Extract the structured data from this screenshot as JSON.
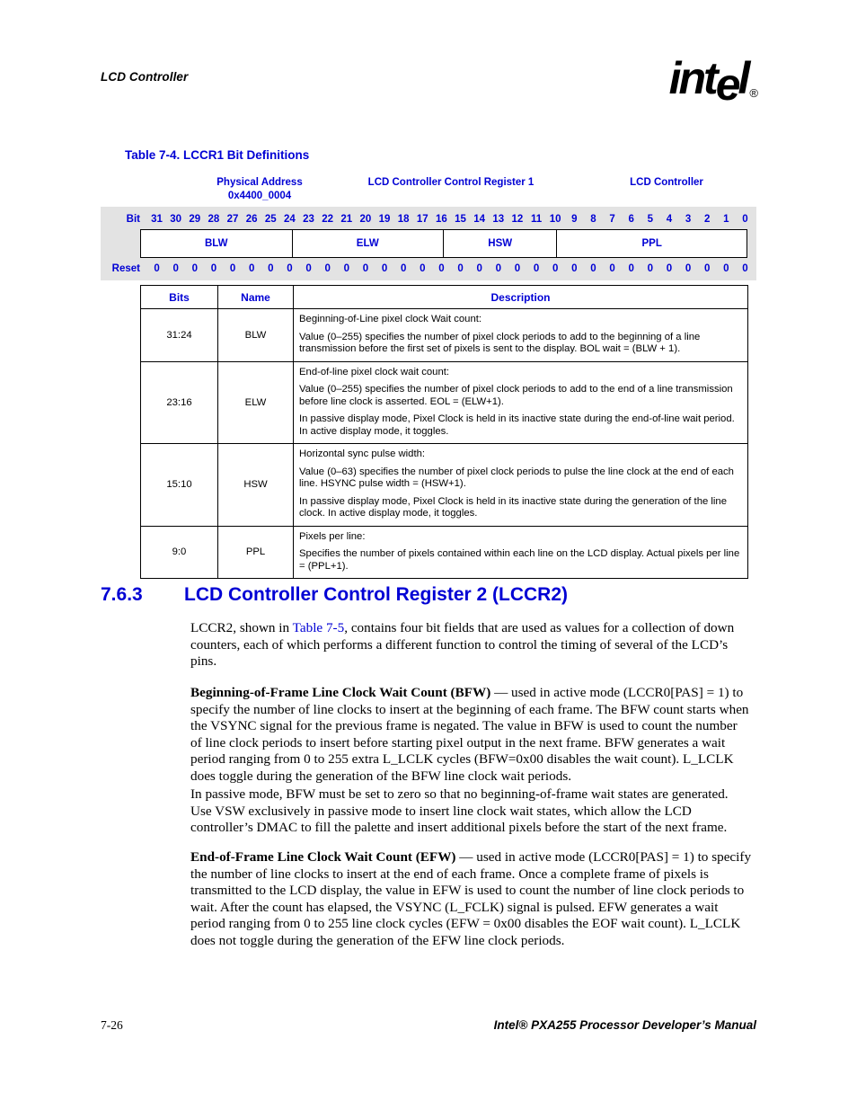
{
  "header": {
    "running_head": "LCD Controller",
    "logo_text": "intel",
    "logo_registered": "®"
  },
  "table": {
    "caption": "Table 7-4. LCCR1 Bit Definitions",
    "register_diagram": {
      "physical_address_label": "Physical Address",
      "physical_address_value": "0x4400_0004",
      "register_name": "LCD Controller Control Register 1",
      "unit_name": "LCD Controller",
      "bit_row_label": "Bit",
      "reset_row_label": "Reset",
      "bits": [
        "31",
        "30",
        "29",
        "28",
        "27",
        "26",
        "25",
        "24",
        "23",
        "22",
        "21",
        "20",
        "19",
        "18",
        "17",
        "16",
        "15",
        "14",
        "13",
        "12",
        "11",
        "10",
        "9",
        "8",
        "7",
        "6",
        "5",
        "4",
        "3",
        "2",
        "1",
        "0"
      ],
      "reset_values": [
        "0",
        "0",
        "0",
        "0",
        "0",
        "0",
        "0",
        "0",
        "0",
        "0",
        "0",
        "0",
        "0",
        "0",
        "0",
        "0",
        "0",
        "0",
        "0",
        "0",
        "0",
        "0",
        "0",
        "0",
        "0",
        "0",
        "0",
        "0",
        "0",
        "0",
        "0",
        "0"
      ],
      "fields": [
        {
          "name": "BLW",
          "span": 8
        },
        {
          "name": "ELW",
          "span": 8
        },
        {
          "name": "HSW",
          "span": 6
        },
        {
          "name": "PPL",
          "span": 10
        }
      ]
    },
    "columns": [
      "Bits",
      "Name",
      "Description"
    ],
    "rows": [
      {
        "bits": "31:24",
        "name": "BLW",
        "description": [
          "Beginning-of-Line pixel clock Wait count:",
          "Value (0–255) specifies the number of pixel clock periods to add to the beginning of a line transmission before the first set of pixels is sent to the display. BOL wait = (BLW + 1)."
        ]
      },
      {
        "bits": "23:16",
        "name": "ELW",
        "description": [
          "End-of-line pixel clock wait count:",
          "Value (0–255) specifies the number of pixel clock periods to add to the end of a line transmission before line clock is asserted. EOL = (ELW+1).",
          "In passive display mode, Pixel Clock is held in its inactive state during the end-of-line wait period. In active display mode, it toggles."
        ]
      },
      {
        "bits": "15:10",
        "name": "HSW",
        "description": [
          "Horizontal sync pulse width:",
          "Value (0–63) specifies the number of pixel clock periods to pulse the line clock at the end of each line. HSYNC pulse width = (HSW+1).",
          "In passive display mode, Pixel Clock is held in its inactive state during the generation of the line clock. In active display mode, it toggles."
        ]
      },
      {
        "bits": "9:0",
        "name": "PPL",
        "description": [
          "Pixels per line:",
          "Specifies the number of pixels contained within each line on the LCD display. Actual pixels per line = (PPL+1)."
        ]
      }
    ]
  },
  "section": {
    "number": "7.6.3",
    "title": "LCD Controller Control Register 2 (LCCR2)",
    "intro_before_link": "LCCR2, shown in ",
    "intro_link": "Table 7-5",
    "intro_after_link": ", contains four bit fields that are used as values for a collection of down counters, each of which performs a different function to control the timing of several of the LCD’s pins.",
    "bfw_term": "Beginning-of-Frame Line Clock Wait Count (BFW)",
    "bfw_text": " — used in active mode (LCCR0[PAS] = 1) to specify the number of line clocks to insert at the beginning of each frame. The BFW count starts when the VSYNC signal for the previous frame is negated. The value in BFW is used to count the number of line clock periods to insert before starting pixel output in the next frame. BFW generates a wait period ranging from 0 to 255 extra L_LCLK cycles (BFW=0x00 disables the wait count). L_LCLK does toggle during the generation of the BFW line clock wait periods.",
    "passive_paragraph": "In passive mode, BFW must be set to zero so that no beginning-of-frame wait states are generated. Use VSW exclusively in passive mode to insert line clock wait states, which allow the LCD controller’s DMAC to fill the palette and insert additional pixels before the start of the next frame.",
    "efw_term": "End-of-Frame Line Clock Wait Count (EFW)",
    "efw_text": " — used in active mode (LCCR0[PAS] = 1) to specify the number of line clocks to insert at the end of each frame. Once a complete frame of pixels is transmitted to the LCD display, the value in EFW is used to count the number of line clock periods to wait. After the count has elapsed, the VSYNC (L_FCLK) signal is pulsed. EFW generates a wait period ranging from 0 to 255 line clock cycles (EFW = 0x00 disables the EOF wait count). L_LCLK does not toggle during the generation of the EFW line clock periods."
  },
  "footer": {
    "page_number": "7-26",
    "manual_title": "Intel® PXA255 Processor Developer’s Manual"
  },
  "colors": {
    "heading_blue": "#0000d4",
    "gray_band": "#e3e3e3",
    "text_black": "#000000"
  }
}
